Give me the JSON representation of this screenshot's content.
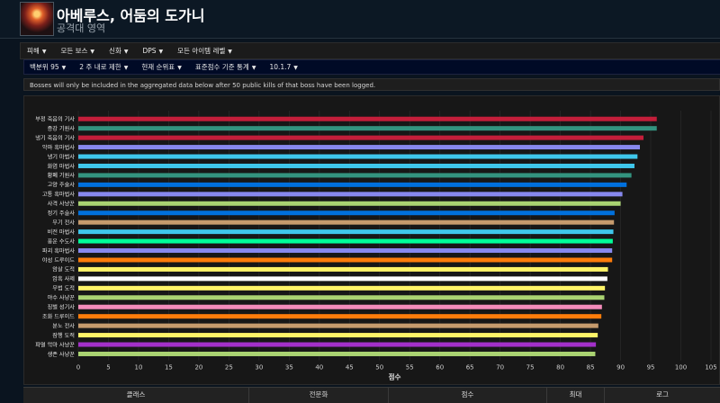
{
  "header": {
    "boss_name": "아베루스, 어둠의 도가니",
    "zone_name": "공격대 영역"
  },
  "menu": [
    {
      "label": "피해"
    },
    {
      "label": "모든 보스"
    },
    {
      "label": "신화"
    },
    {
      "label": "DPS"
    },
    {
      "label": "모든 아이템 레벨"
    }
  ],
  "filters": [
    {
      "label": "백분위 95"
    },
    {
      "label": "2 주 내로 제한"
    },
    {
      "label": "현재 순위표"
    },
    {
      "label": "표준점수 기준 통계"
    },
    {
      "label": "10.1.7"
    }
  ],
  "notice": "Bosses will only be included in the aggregated data below after 50 public kills of that boss have been logged.",
  "chart_data": {
    "type": "bar",
    "orientation": "horizontal",
    "xlabel": "점수",
    "xlim": [
      0,
      105
    ],
    "xticks": [
      0,
      5,
      10,
      15,
      20,
      25,
      30,
      35,
      40,
      45,
      50,
      55,
      60,
      65,
      70,
      75,
      80,
      85,
      90,
      95,
      100,
      105
    ],
    "grid": true,
    "categories": [
      "부정 죽음의 기사",
      "증강 기원사",
      "냉기 죽음의 기사",
      "악마 흑마법사",
      "냉기 마법사",
      "화염 마법사",
      "황폐 기원사",
      "고양 주술사",
      "고통 흑마법사",
      "사격 사냥꾼",
      "정기 주술사",
      "무기 전사",
      "비전 마법사",
      "풍운 수도사",
      "파괴 흑마법사",
      "야성 드루이드",
      "암살 도적",
      "암흑 사제",
      "무법 도적",
      "야수 사냥꾼",
      "징벌 성기사",
      "조화 드루이드",
      "분노 전사",
      "잠행 도적",
      "파멸 악마 사냥꾼",
      "생존 사냥꾼"
    ],
    "values": [
      96.0,
      96.0,
      93.8,
      93.2,
      92.8,
      92.3,
      91.8,
      91.0,
      90.3,
      90.0,
      89.0,
      88.9,
      88.8,
      88.7,
      88.6,
      88.6,
      87.9,
      87.8,
      87.4,
      87.3,
      86.9,
      86.8,
      86.3,
      86.2,
      85.9,
      85.8
    ],
    "colors": [
      "#c41e3a",
      "#33937f",
      "#c41e3a",
      "#8788ee",
      "#3fc7eb",
      "#3fc7eb",
      "#33937f",
      "#0070dd",
      "#8788ee",
      "#aad372",
      "#0070dd",
      "#c69b6d",
      "#3fc7eb",
      "#00ff98",
      "#8788ee",
      "#ff7c0a",
      "#fff468",
      "#ffffff",
      "#fff468",
      "#aad372",
      "#f48cba",
      "#ff7c0a",
      "#c69b6d",
      "#fff468",
      "#a330c9",
      "#aad372"
    ]
  },
  "table": {
    "headers": [
      "클래스",
      "전문화",
      "점수",
      "최대",
      "로그"
    ]
  }
}
